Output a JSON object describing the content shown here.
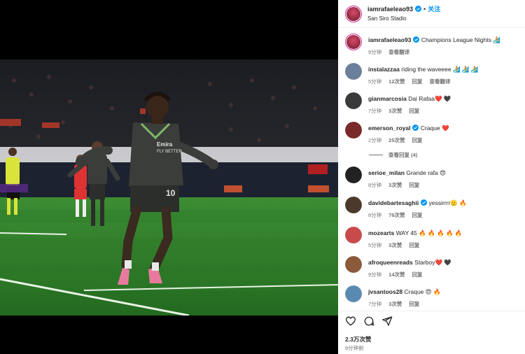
{
  "post": {
    "author": "iamrafaeleao93",
    "follow_label": "关注",
    "location": "San Siro Stadio",
    "verified": true
  },
  "caption": {
    "username": "iamrafaeleao93",
    "text": "Champions League Nights 🏄",
    "time": "9分钟",
    "translate": "查看翻译"
  },
  "comments": [
    {
      "username": "instalazzaa",
      "text": "riding the waveeee 🏄 🏄 🏄",
      "verified": false,
      "time": "5分钟",
      "likes": "12次赞",
      "reply": "回复",
      "translate": "查看翻译",
      "avatar_color": "#6a7f9a"
    },
    {
      "username": "gianmarcosia",
      "text": "Dai Rafaa❤️ 🖤",
      "verified": false,
      "time": "7分钟",
      "likes": "3次赞",
      "reply": "回复",
      "translate": "",
      "avatar_color": "#3a3a3a"
    },
    {
      "username": "emerson_royal",
      "text": "Craque ❤️",
      "verified": true,
      "time": "2分钟",
      "likes": "25次赞",
      "reply": "回复",
      "translate": "",
      "avatar_color": "#7a2a2a"
    },
    {
      "username": "serioe_milan",
      "text": "Grande rafa 😍",
      "verified": false,
      "time": "8分钟",
      "likes": "3次赞",
      "reply": "回复",
      "translate": "",
      "avatar_color": "#222222"
    },
    {
      "username": "davidebartesaghii",
      "text": "yessirrrr🫡 🔥",
      "verified": true,
      "time": "8分钟",
      "likes": "76次赞",
      "reply": "回复",
      "translate": "",
      "avatar_color": "#4b3a2b"
    },
    {
      "username": "mozearts",
      "text": "WAY 45 🔥 🔥 🔥 🔥 🔥",
      "verified": false,
      "time": "5分钟",
      "likes": "3次赞",
      "reply": "回复",
      "translate": "",
      "avatar_color": "#c94a4a"
    },
    {
      "username": "afroqueenreads",
      "text": "Starboy❤️ 🖤",
      "verified": false,
      "time": "9分钟",
      "likes": "14次赞",
      "reply": "回复",
      "translate": "",
      "avatar_color": "#8a5a3a"
    },
    {
      "username": "jvsantoos28",
      "text": "Craque 😍 🔥",
      "verified": false,
      "time": "7分钟",
      "likes": "3次赞",
      "reply": "回复",
      "translate": "",
      "avatar_color": "#5a8ab0"
    }
  ],
  "view_replies": "查看回复 (4)",
  "footer": {
    "likes": "2.3万次赞",
    "posted": "9分钟前"
  },
  "icons": {
    "like": "heart-icon",
    "comment": "comment-icon",
    "share": "share-icon",
    "verified": "verified-badge-icon"
  },
  "colors": {
    "accent": "#0095f6",
    "text": "#262626",
    "muted": "#737373",
    "pitch": "#2f7d2a",
    "kit": "#3b3d3a"
  }
}
